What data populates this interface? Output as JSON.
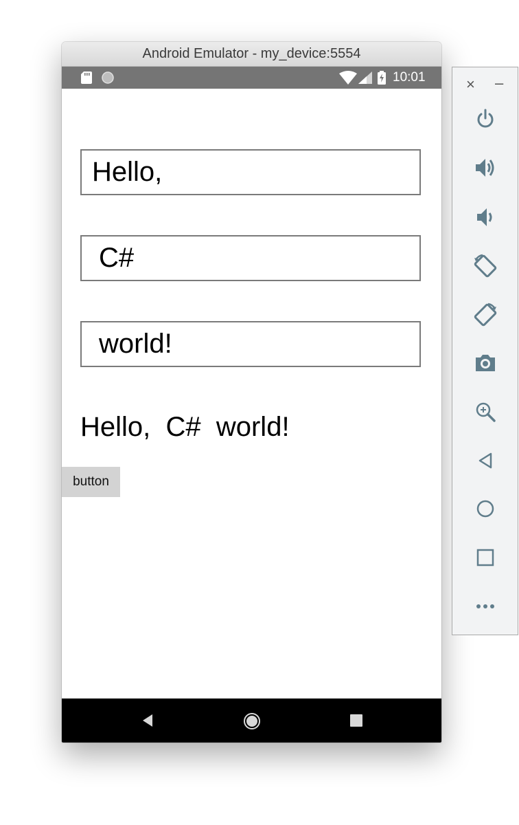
{
  "window": {
    "title": "Android Emulator - my_device:5554"
  },
  "status_bar": {
    "time": "10:01",
    "icons": [
      "sd-card-icon",
      "circle-icon",
      "wifi-icon",
      "signal-icon",
      "battery-charging-icon"
    ]
  },
  "app": {
    "entries": [
      {
        "value": "Hello,"
      },
      {
        "value": "C#"
      },
      {
        "value": "world!"
      }
    ],
    "result_text": "Hello,  C#  world!",
    "button_label": "button"
  },
  "nav_bar": {
    "icons": [
      "back-icon",
      "home-icon",
      "recents-icon"
    ]
  },
  "toolbar": {
    "close_label": "×",
    "minimize_label": "–",
    "icons": [
      "power-icon",
      "volume-up-icon",
      "volume-down-icon",
      "rotate-left-icon",
      "rotate-right-icon",
      "camera-icon",
      "zoom-icon",
      "back-icon",
      "home-icon",
      "overview-icon",
      "more-icon"
    ]
  },
  "colors": {
    "status_bar": "#757575",
    "nav_bar": "#000000",
    "toolbar_icon": "#607d8b",
    "entry_border": "#7a7a7a",
    "button_bg": "#d3d3d3"
  }
}
